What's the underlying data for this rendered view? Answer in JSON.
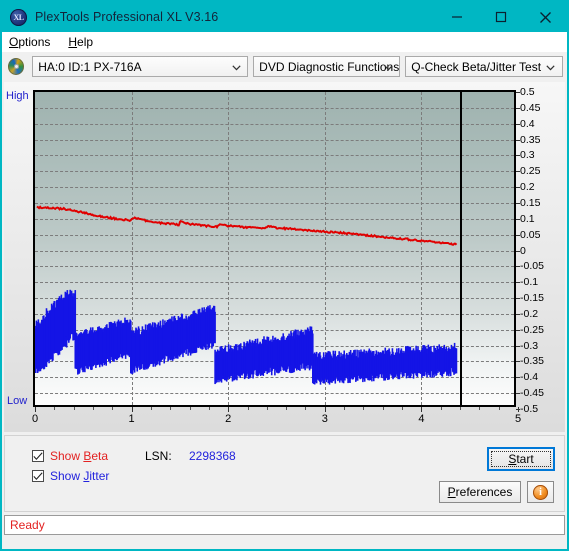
{
  "window": {
    "title": "PlexTools Professional XL V3.16",
    "app_icon": "xl-disc-icon",
    "titlebar_color": "#00b7c3",
    "minimize_label": "minimize-icon",
    "maximize_label": "maximize-icon",
    "close_label": "close-icon"
  },
  "menubar": {
    "items": [
      {
        "label": "Options",
        "accel": "O"
      },
      {
        "label": "Help",
        "accel": "H"
      }
    ]
  },
  "toolbar": {
    "drive_icon": "disc-icon",
    "drive_combo": {
      "value": "HA:0 ID:1  PX-716A",
      "arrow": "chevron-down-icon"
    },
    "function_combo": {
      "value": "DVD Diagnostic Functions",
      "arrow": "chevron-down-icon"
    },
    "test_combo": {
      "value": "Q-Check Beta/Jitter Test",
      "arrow": "chevron-down-icon"
    }
  },
  "chart_data": {
    "type": "line",
    "title": "",
    "xlabel": "",
    "ylabel": "",
    "axis_high_label": "High",
    "axis_low_label": "Low",
    "xlim": [
      0,
      5
    ],
    "ylim": [
      -0.5,
      0.5
    ],
    "grid": true,
    "xticks": [
      0,
      1,
      2,
      3,
      4,
      5
    ],
    "yticks": [
      0.5,
      0.45,
      0.4,
      0.35,
      0.3,
      0.25,
      0.2,
      0.15,
      0.1,
      0.05,
      0,
      -0.05,
      -0.1,
      -0.15,
      -0.2,
      -0.25,
      -0.3,
      -0.35,
      -0.4,
      -0.45,
      -0.5
    ],
    "data_end_x": 4.4,
    "colors": {
      "beta": "#e00000",
      "jitter": "#1414e6"
    },
    "series": [
      {
        "name": "Beta",
        "color": "#e00000",
        "kind": "line",
        "x": [
          0.02,
          0.1,
          0.2,
          0.3,
          0.4,
          0.5,
          0.6,
          0.7,
          0.8,
          0.9,
          1.0,
          1.03,
          1.1,
          1.2,
          1.3,
          1.4,
          1.5,
          1.52,
          1.6,
          1.7,
          1.8,
          1.9,
          1.95,
          2.0,
          2.1,
          2.2,
          2.3,
          2.4,
          2.45,
          2.5,
          2.6,
          2.7,
          2.8,
          2.9,
          3.0,
          3.1,
          3.2,
          3.3,
          3.4,
          3.5,
          3.6,
          3.7,
          3.8,
          3.9,
          4.0,
          4.1,
          4.2,
          4.3,
          4.4
        ],
        "y": [
          0.132,
          0.13,
          0.129,
          0.127,
          0.122,
          0.115,
          0.108,
          0.102,
          0.097,
          0.093,
          0.09,
          0.098,
          0.092,
          0.086,
          0.082,
          0.079,
          0.076,
          0.086,
          0.079,
          0.075,
          0.072,
          0.069,
          0.078,
          0.073,
          0.07,
          0.068,
          0.066,
          0.064,
          0.072,
          0.067,
          0.064,
          0.062,
          0.06,
          0.057,
          0.055,
          0.052,
          0.05,
          0.047,
          0.044,
          0.041,
          0.038,
          0.035,
          0.032,
          0.029,
          0.026,
          0.023,
          0.02,
          0.016,
          0.012
        ]
      },
      {
        "name": "Jitter",
        "color": "#1414e6",
        "kind": "band",
        "zones": [
          {
            "x_start": 0.0,
            "x_end": 0.12,
            "top_start": -0.25,
            "top_end": -0.215,
            "bottom_start": -0.385,
            "bottom_end": -0.37
          },
          {
            "x_start": 0.12,
            "x_end": 0.33,
            "top_start": -0.21,
            "top_end": -0.15,
            "bottom_start": -0.36,
            "bottom_end": -0.3
          },
          {
            "x_start": 0.33,
            "x_end": 0.42,
            "top_start": -0.148,
            "top_end": -0.145,
            "bottom_start": -0.29,
            "bottom_end": -0.275
          },
          {
            "x_start": 0.42,
            "x_end": 1.0,
            "top_start": -0.285,
            "top_end": -0.235,
            "bottom_start": -0.39,
            "bottom_end": -0.33
          },
          {
            "x_start": 1.0,
            "x_end": 1.88,
            "top_start": -0.275,
            "top_end": -0.195,
            "bottom_start": -0.385,
            "bottom_end": -0.3
          },
          {
            "x_start": 1.88,
            "x_end": 2.9,
            "top_start": -0.335,
            "top_end": -0.265,
            "bottom_start": -0.415,
            "bottom_end": -0.37
          },
          {
            "x_start": 2.9,
            "x_end": 4.4,
            "top_start": -0.35,
            "top_end": -0.32,
            "bottom_start": -0.42,
            "bottom_end": -0.39
          }
        ]
      }
    ]
  },
  "controls": {
    "show_beta": {
      "label": "Show Beta",
      "accel": "B",
      "checked": true,
      "color": "#e32222"
    },
    "show_jitter": {
      "label": "Show Jitter",
      "accel": "J",
      "checked": true,
      "color": "#2222dd"
    },
    "lsn_label": "LSN:",
    "lsn_value": "2298368",
    "start_button": {
      "label": "Start",
      "accel": "S",
      "focused": true
    },
    "preferences_button": {
      "label": "Preferences",
      "accel": "P"
    },
    "info_button": {
      "glyph": "i",
      "name": "info-icon"
    }
  },
  "statusbar": {
    "text": "Ready",
    "color": "#e32222"
  }
}
